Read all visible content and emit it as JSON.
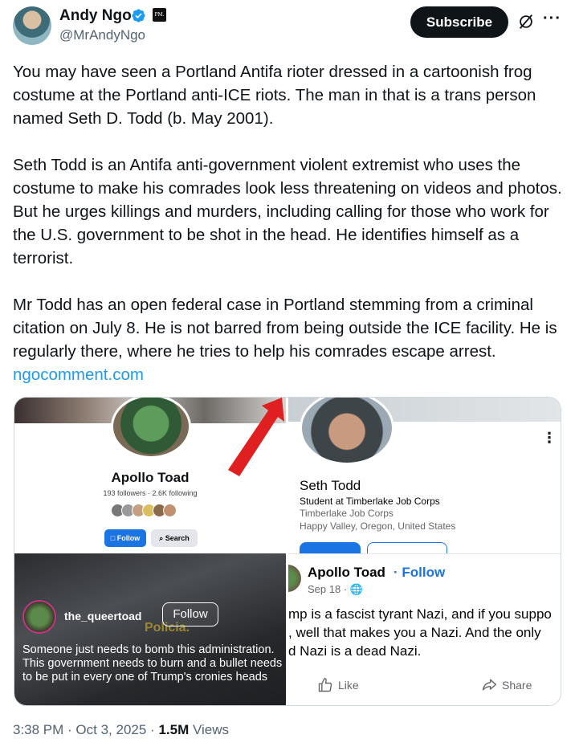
{
  "author": {
    "name": "Andy Ngo",
    "handle": "@MrAndyNgo",
    "affiliate_badge": "PM."
  },
  "header": {
    "subscribe_label": "Subscribe",
    "grok_icon": "grok-icon",
    "more_icon": "more-icon"
  },
  "tweet": {
    "paragraphs": [
      "You may have seen a Portland Antifa rioter dressed in a cartoonish frog costume at the Portland anti-ICE riots. The man in that is a trans person named Seth D. Todd (b. May 2001).",
      "Seth Todd is an Antifa anti-government violent extremist who uses the costume to make his comrades look less threatening on videos and photos. But he urges killings and murders, including calling for those who work for the U.S. government to be shot in the head. He identifies himself as a terrorist.",
      "Mr Todd has an open federal case in Portland stemming from a criminal citation on July 8. He is not barred from being outside the ICE facility. He is regularly there, where he tries to help his comrades escape arrest."
    ],
    "link": "ngocomment.com"
  },
  "media": {
    "left": {
      "profile_name": "Apollo Toad",
      "stats": "193 followers · 2.6K following",
      "follow_label": "Follow",
      "search_label": "Search",
      "reel_user": "the_queertoad",
      "reel_follow": "Follow",
      "reel_watermark": "Policia.",
      "reel_caption": "Someone just needs to bomb this administration. This government needs to burn and a bullet needs to be put in every one of Trump's cronies heads"
    },
    "right": {
      "profile_name": "Seth Todd",
      "line1": "Student at Timberlake Job Corps",
      "line2": "Timberlake Job Corps",
      "line3": "Happy Valley, Oregon, United States",
      "post_author": "Apollo Toad",
      "post_follow": "· Follow",
      "post_date": "Sep 18 ·",
      "post_lines": [
        "mp is a fascist tyrant Nazi, and if you suppo",
        ", well that makes you a Nazi. And the only",
        "d Nazi is a dead Nazi."
      ],
      "like_label": "Like",
      "share_label": "Share"
    }
  },
  "footer": {
    "time": "3:38 PM · Oct 3, 2025 ·",
    "views_count": "1.5M",
    "views_label": "Views"
  },
  "colors": {
    "link": "#1d9bf0",
    "verified": "#1d9bf0",
    "fb_blue": "#1b74e4",
    "muted": "#536471"
  }
}
